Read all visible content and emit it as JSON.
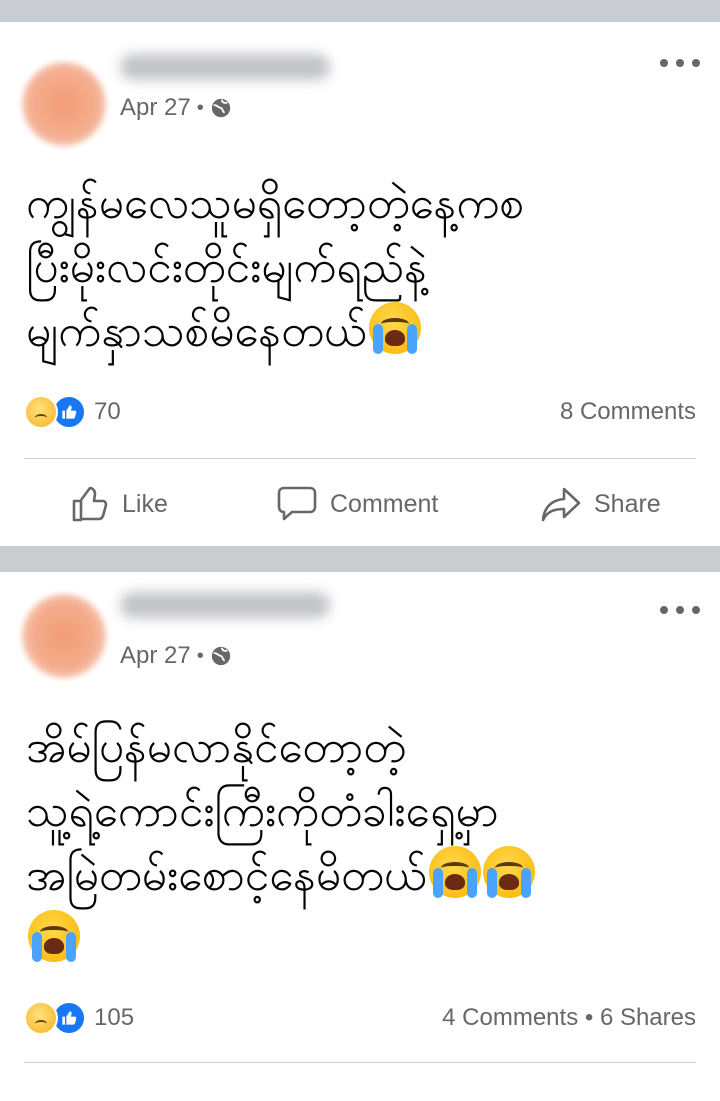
{
  "posts": [
    {
      "date": "Apr 27",
      "separator": "•",
      "text": "ကျွန်မလေသူမရှိတော့တဲ့နေ့ကစ\nပြီးမိုးလင်းတိုင်းမျက်ရည်နဲ့\nမျက်နှာသစ်မိနေတယ်",
      "emoji_count": 1,
      "reaction_count": "70",
      "stats_right": "8 Comments",
      "actions": {
        "like": "Like",
        "comment": "Comment",
        "share": "Share"
      }
    },
    {
      "date": "Apr 27",
      "separator": "•",
      "text_lines": [
        "အိမ်ပြန်မလာနိုင်တော့တဲ့",
        "သူ့ရဲ့ကောင်းကြီးကိုတံခါးရှေ့မှာ",
        "အမြဲတမ်းစောင့်နေမိတယ်"
      ],
      "reaction_count": "105",
      "stats_right": "4 Comments • 6 Shares"
    }
  ],
  "icons": [
    "more-icon",
    "globe-icon",
    "crying-emoji-icon",
    "sad-reaction-icon",
    "like-reaction-icon",
    "like-icon",
    "comment-icon",
    "share-icon"
  ],
  "colors": {
    "background": "#c9ccd1",
    "card": "#ffffff",
    "meta_text": "#65676b",
    "like_blue": "#1877f2"
  }
}
